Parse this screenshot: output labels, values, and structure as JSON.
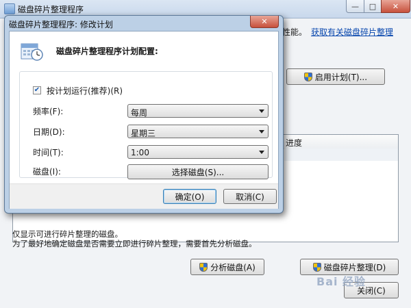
{
  "main_window": {
    "title": "磁盘碎片整理程序",
    "window_buttons": {
      "minimize": "—",
      "maximize": "□",
      "close": "✕"
    },
    "desc_tail": "性能。",
    "help_link": "获取有关磁盘碎片整理",
    "enable_schedule_label": "启用计划(T)...",
    "column_progress": "进度",
    "info_line1": "仅显示可进行碎片整理的磁盘。",
    "info_line2": "为了最好地确定磁盘是否需要立即进行碎片整理，需要首先分析磁盘。",
    "analyze_button": "分析磁盘(A)",
    "defrag_button": "磁盘碎片整理(D)",
    "close_button": "关闭(C)"
  },
  "dialog": {
    "title": "磁盘碎片整理程序: 修改计划",
    "close_glyph": "✕",
    "heading": "磁盘碎片整理程序计划配置:",
    "run_on_schedule_label": "按计划运行(推荐)(R)",
    "run_on_schedule_checked": true,
    "frequency_label": "频率(F):",
    "frequency_value": "每周",
    "day_label": "日期(D):",
    "day_value": "星期三",
    "time_label": "时间(T):",
    "time_value": "1:00",
    "disks_label": "磁盘(I):",
    "select_disks_button": "选择磁盘(S)...",
    "ok_button": "确定(O)",
    "cancel_button": "取消(C)"
  },
  "watermark": "Bai 经验",
  "colors": {
    "link": "#0645ad",
    "close_red": "#c7513c",
    "dialog_frame": "#bcd0e6"
  }
}
